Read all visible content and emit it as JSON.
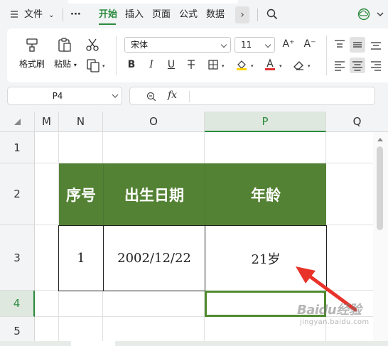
{
  "menubar": {
    "file_label": "文件",
    "more_icon": "···",
    "tabs": [
      {
        "label": "开始",
        "active": true
      },
      {
        "label": "插入"
      },
      {
        "label": "页面"
      },
      {
        "label": "公式"
      },
      {
        "label": "数据"
      }
    ],
    "more_tabs_icon": "›"
  },
  "ribbon": {
    "format_painter_label": "格式刷",
    "paste_label": "粘贴",
    "font_name": "宋体",
    "font_size": "11",
    "increase_font_glyph": "A⁺",
    "decrease_font_glyph": "A⁻",
    "bold_glyph": "B",
    "italic_glyph": "I",
    "underline_glyph": "U",
    "fill_color": "#ffd400",
    "font_color": "#e03131",
    "brand_color": "#2b8a3e"
  },
  "formula_bar": {
    "cell_reference": "P4",
    "fx_glyph": "fx",
    "content": ""
  },
  "grid": {
    "columns": [
      "M",
      "N",
      "O",
      "P",
      "Q"
    ],
    "active_column": "P",
    "rows": [
      "1",
      "2",
      "3",
      "4",
      "5"
    ],
    "active_row": "4",
    "header_fill": "#548235",
    "headers": [
      "序号",
      "出生日期",
      "年龄"
    ],
    "data_row": [
      "1",
      "2002/12/22",
      "21岁"
    ]
  },
  "watermark": {
    "main": "Baidu经验",
    "sub": "jingyan.baidu.com"
  }
}
